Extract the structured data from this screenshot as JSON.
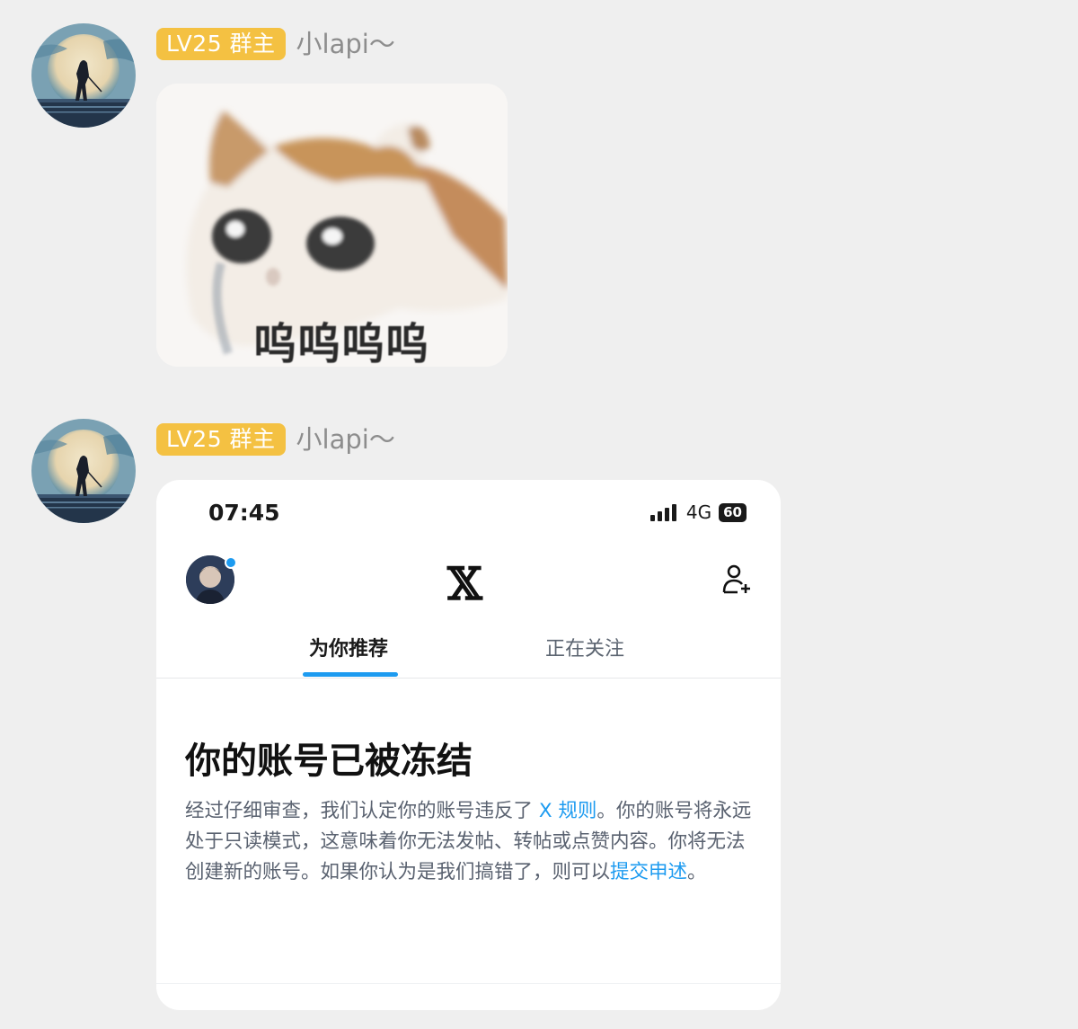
{
  "messages": [
    {
      "badge": "LV25 群主",
      "sender": "小lapi～",
      "sticker": {
        "caption": "呜呜呜呜"
      }
    },
    {
      "badge": "LV25 群主",
      "sender": "小lapi～",
      "screenshot": {
        "status_time": "07:45",
        "network": "4G",
        "battery": "60",
        "tabs": [
          "为你推荐",
          "正在关注"
        ],
        "title": "你的账号已被冻结",
        "body_part1": "经过仔细审查，我们认定你的账号违反了 ",
        "link_rules": "X 规则",
        "body_part2": "。你的账号将永远处于只读模式，这意味着你无法发帖、转帖或点赞内容。你将无法创建新的账号。如果你认为是我们搞错了，则可以",
        "link_appeal": "提交申述",
        "body_end": "。"
      }
    }
  ],
  "colors": {
    "badge_bg": "#f4c142",
    "link": "#1d9bf0",
    "chat_bg": "#efefef"
  },
  "icons": [
    "avatar-image",
    "signal-icon",
    "battery-icon",
    "x-logo-icon",
    "add-user-icon"
  ]
}
